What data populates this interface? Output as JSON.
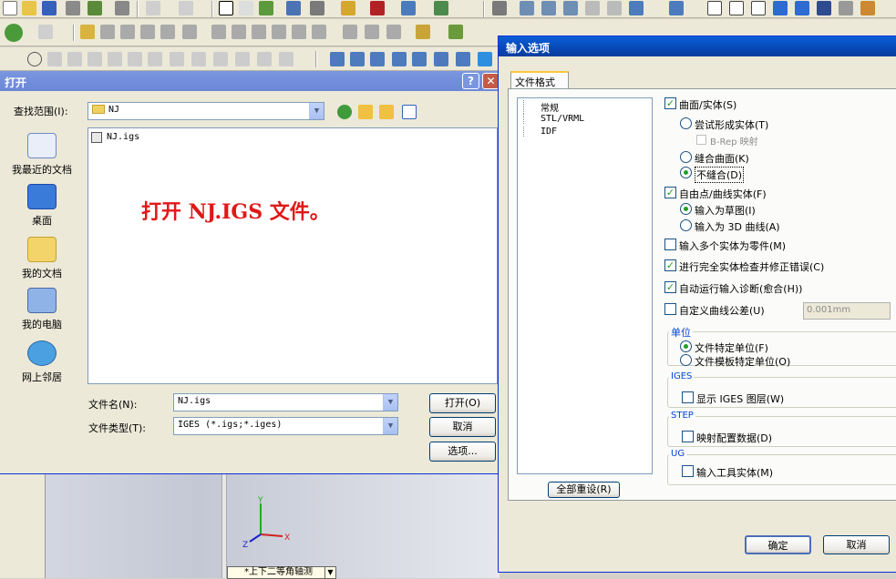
{
  "open_dialog": {
    "title": "打开",
    "look_in_label": "查找范围(I):",
    "look_in_value": "NJ",
    "places": [
      {
        "label": "我最近的文档",
        "icon": "recent-documents-icon"
      },
      {
        "label": "桌面",
        "icon": "desktop-icon"
      },
      {
        "label": "我的文档",
        "icon": "my-documents-icon"
      },
      {
        "label": "我的电脑",
        "icon": "my-computer-icon"
      },
      {
        "label": "网上邻居",
        "icon": "network-places-icon"
      }
    ],
    "files": [
      {
        "name": "NJ.igs"
      }
    ],
    "annotation": "打开 NJ.IGS 文件。",
    "filename_label": "文件名(N):",
    "filename_value": "NJ.igs",
    "filetype_label": "文件类型(T):",
    "filetype_value": "IGES (*.igs;*.iges)",
    "open_button": "打开(O)",
    "cancel_button": "取消",
    "options_button": "选项..."
  },
  "import_dialog": {
    "title": "输入选项",
    "tab_label": "文件格式",
    "tree_items": [
      "常规",
      "STL/VRML",
      "IDF"
    ],
    "reset_button": "全部重设(R)",
    "surfaces_solids": {
      "label": "曲面/实体(S)",
      "checked": true
    },
    "try_form_solid": {
      "label": "尝试形成实体(T)",
      "selected": false
    },
    "brep_mapping": {
      "label": "B-Rep 映射",
      "checked": false
    },
    "knit_surfaces": {
      "label": "缝合曲面(K)",
      "selected": false
    },
    "do_not_knit": {
      "label": "不缝合(D)",
      "selected": true
    },
    "free_point_curve": {
      "label": "自由点/曲线实体(F)",
      "checked": true
    },
    "import_as_sketch": {
      "label": "输入为草图(I)",
      "selected": true
    },
    "import_as_3d_curve": {
      "label": "输入为 3D 曲线(A)",
      "selected": false
    },
    "import_multiple_as_parts": {
      "label": "输入多个实体为零件(M)",
      "checked": false
    },
    "full_entity_check": {
      "label": "进行完全实体检查并修正错误(C)",
      "checked": true
    },
    "auto_run_diagnostics": {
      "label": "自动运行输入诊断(愈合(H))",
      "checked": true
    },
    "custom_curve_tolerance": {
      "label": "自定义曲线公差(U)",
      "checked": false,
      "value": "0.001mm"
    },
    "units_group": {
      "title": "单位",
      "file_units": "文件特定单位(F)",
      "template_units": "文件模板特定单位(O)",
      "selected": "file_units"
    },
    "iges_group": {
      "title": "IGES",
      "show_layers": "显示 IGES 图层(W)",
      "checked": false
    },
    "step_group": {
      "title": "STEP",
      "map_config": "映射配置数据(D)",
      "checked": false
    },
    "ug_group": {
      "title": "UG",
      "import_tool_bodies": "输入工具实体(M)",
      "checked": false
    },
    "ok_button": "确定",
    "cancel_button": "取消"
  },
  "viewport": {
    "view_name": "*上下二等角轴测",
    "axes": [
      "Y",
      "X",
      "Z"
    ]
  }
}
